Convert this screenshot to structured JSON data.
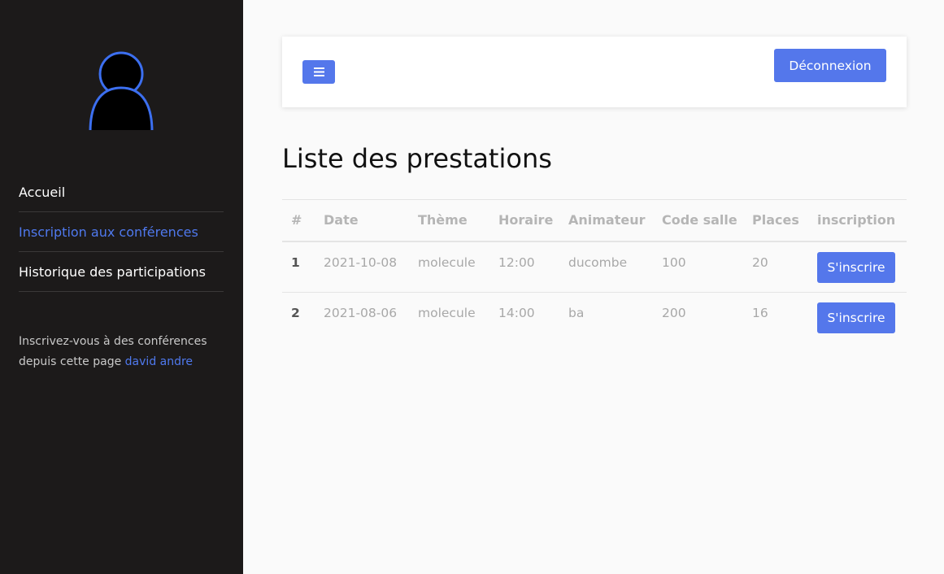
{
  "sidebar": {
    "nav": [
      {
        "label": "Accueil",
        "active": false
      },
      {
        "label": "Inscription aux conférences",
        "active": true
      },
      {
        "label": "Historique des participations",
        "active": false
      }
    ],
    "note_text": "Inscrivez-vous à des conférences depuis cette page ",
    "note_user": "david andre"
  },
  "topbar": {
    "toggle_icon": "bars-icon",
    "logout_label": "Déconnexion"
  },
  "page_title": "Liste des prestations",
  "table": {
    "headers": [
      "#",
      "Date",
      "Thème",
      "Horaire",
      "Animateur",
      "Code salle",
      "Places",
      "inscription"
    ],
    "rows": [
      {
        "num": "1",
        "date": "2021-10-08",
        "theme": "molecule",
        "horaire": "12:00",
        "animateur": "ducombe",
        "code_salle": "100",
        "places": "20",
        "action": "S'inscrire"
      },
      {
        "num": "2",
        "date": "2021-08-06",
        "theme": "molecule",
        "horaire": "14:00",
        "animateur": "ba",
        "code_salle": "200",
        "places": "16",
        "action": "S'inscrire"
      }
    ]
  },
  "colors": {
    "sidebar_bg": "#1c1a1a",
    "accent": "#5477eb",
    "active_link": "#4f79ee"
  }
}
